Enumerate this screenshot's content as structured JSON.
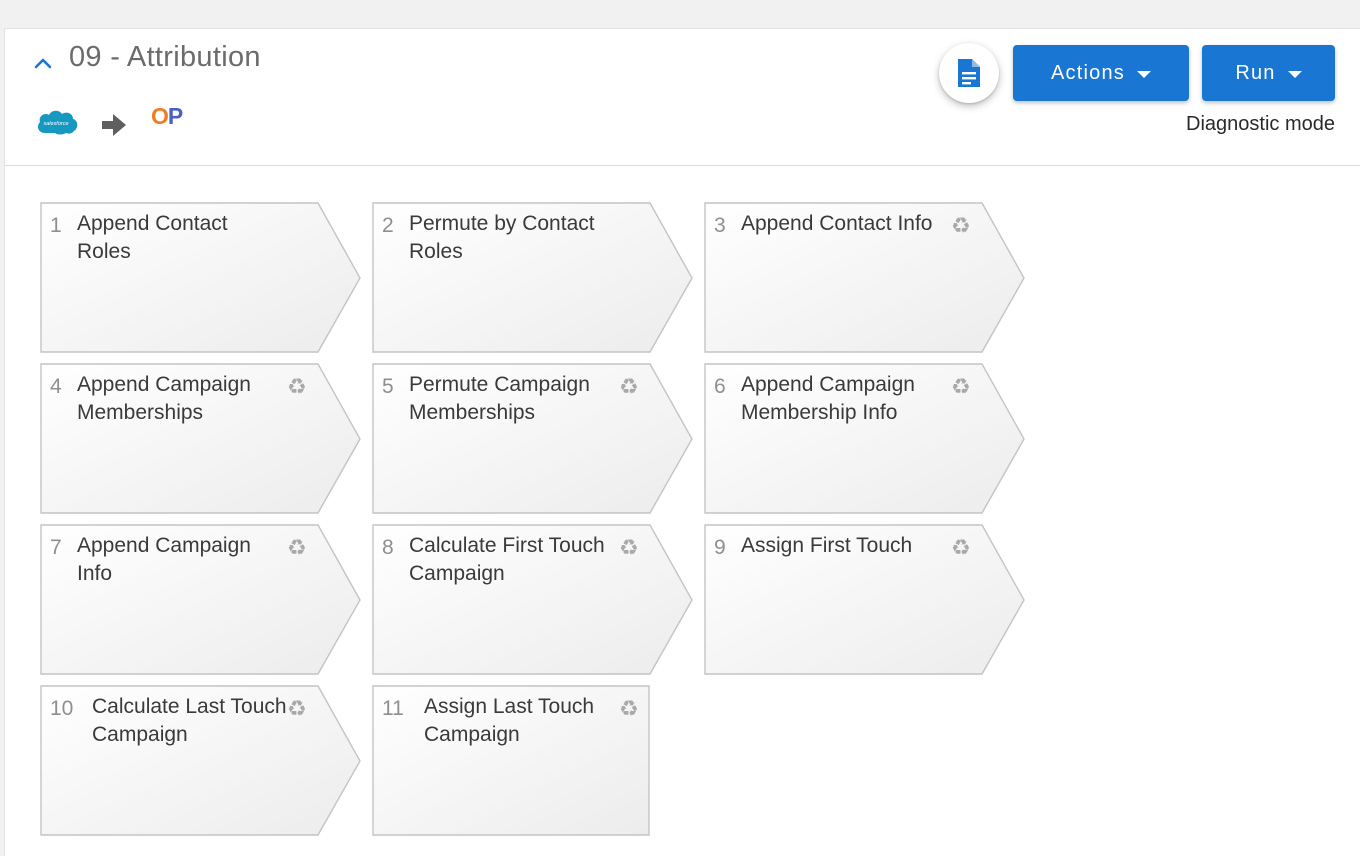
{
  "header": {
    "title": "09 - Attribution",
    "source_logo_text": "salesforce",
    "target_logo": {
      "o": "O",
      "p": "P"
    },
    "actions_label": "Actions",
    "run_label": "Run",
    "diagnostic_label": "Diagnostic mode",
    "icons": {
      "collapse": "chevron-up-icon",
      "source": "salesforce-cloud-icon",
      "flow": "arrow-right-icon",
      "doc": "document-icon",
      "dropdown": "caret-down-icon"
    },
    "colors": {
      "primary": "#1976d2",
      "chevron": "#1976d2",
      "salesforce": "#1798c1",
      "op_o": "#ef7d23",
      "op_p": "#4c5fc0"
    }
  },
  "steps": [
    {
      "num": "1",
      "label": "Append Contact Roles",
      "recycle": false
    },
    {
      "num": "2",
      "label": "Permute by Contact Roles",
      "recycle": false
    },
    {
      "num": "3",
      "label": "Append Contact Info",
      "recycle": true
    },
    {
      "num": "4",
      "label": "Append Campaign Memberships",
      "recycle": true
    },
    {
      "num": "5",
      "label": "Permute Campaign Memberships",
      "recycle": true
    },
    {
      "num": "6",
      "label": "Append Campaign Membership Info",
      "recycle": true
    },
    {
      "num": "7",
      "label": "Append Campaign Info",
      "recycle": true
    },
    {
      "num": "8",
      "label": "Calculate First Touch Campaign",
      "recycle": true
    },
    {
      "num": "9",
      "label": "Assign First Touch",
      "recycle": true
    },
    {
      "num": "10",
      "label": "Calculate Last Touch Campaign",
      "recycle": true
    },
    {
      "num": "11",
      "label": "Assign Last Touch Campaign",
      "recycle": true
    }
  ],
  "recycle_glyph": "♻"
}
